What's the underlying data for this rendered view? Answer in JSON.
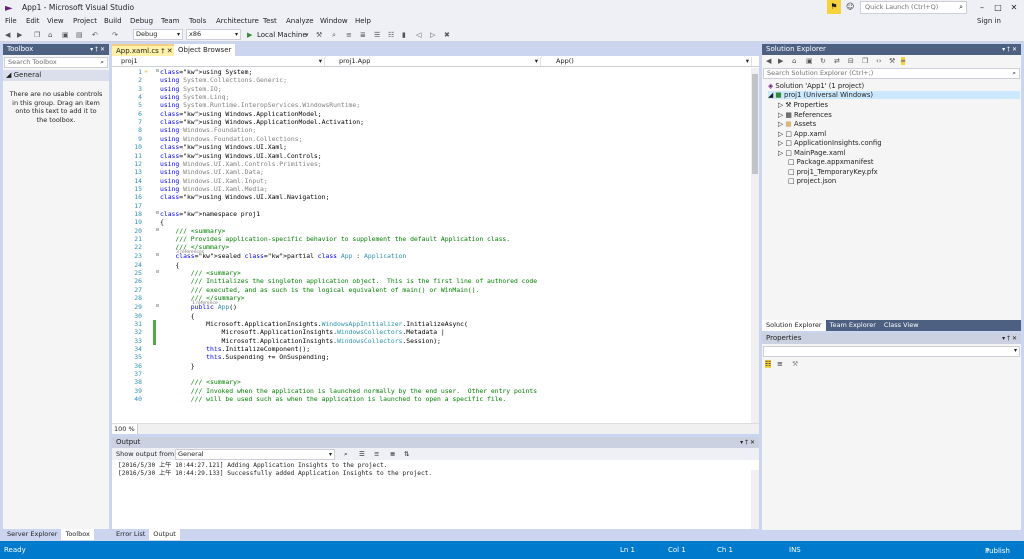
{
  "window": {
    "title": "App1 - Microsoft Visual Studio",
    "quick_launch": "Quick Launch (Ctrl+Q)",
    "sign_in": "Sign in"
  },
  "menu": [
    "File",
    "Edit",
    "View",
    "Project",
    "Build",
    "Debug",
    "Team",
    "Tools",
    "Architecture",
    "Test",
    "Analyze",
    "Window",
    "Help"
  ],
  "toolbar": {
    "config": "Debug",
    "platform": "x86",
    "run_label": "Local Machine"
  },
  "toolbox": {
    "title": "Toolbox",
    "search": "Search Toolbox",
    "group": "General",
    "empty_text": "There are no usable controls in this group. Drag an item onto this text to add it to the toolbox.",
    "tabs": [
      "Server Explorer",
      "Toolbox"
    ]
  },
  "editor": {
    "tabs": [
      "App.xaml.cs",
      "Object Browser"
    ],
    "nav": [
      "proj1",
      "proj1.App",
      "App()"
    ],
    "zoom": "100 %",
    "refs1": "3 references",
    "refs2": "1 reference",
    "lines": [
      {
        "n": "1",
        "t": "using System;"
      },
      {
        "n": "2",
        "t": "using System.Collections.Generic;"
      },
      {
        "n": "3",
        "t": "using System.IO;"
      },
      {
        "n": "4",
        "t": "using System.Linq;"
      },
      {
        "n": "5",
        "t": "using System.Runtime.InteropServices.WindowsRuntime;"
      },
      {
        "n": "6",
        "t": "using Windows.ApplicationModel;"
      },
      {
        "n": "7",
        "t": "using Windows.ApplicationModel.Activation;"
      },
      {
        "n": "8",
        "t": "using Windows.Foundation;"
      },
      {
        "n": "9",
        "t": "using Windows.Foundation.Collections;"
      },
      {
        "n": "10",
        "t": "using Windows.UI.Xaml;"
      },
      {
        "n": "11",
        "t": "using Windows.UI.Xaml.Controls;"
      },
      {
        "n": "12",
        "t": "using Windows.UI.Xaml.Controls.Primitives;"
      },
      {
        "n": "13",
        "t": "using Windows.UI.Xaml.Data;"
      },
      {
        "n": "14",
        "t": "using Windows.UI.Xaml.Input;"
      },
      {
        "n": "15",
        "t": "using Windows.UI.Xaml.Media;"
      },
      {
        "n": "16",
        "t": "using Windows.UI.Xaml.Navigation;"
      },
      {
        "n": "17",
        "t": ""
      },
      {
        "n": "18",
        "t": "namespace proj1"
      },
      {
        "n": "19",
        "t": "{"
      },
      {
        "n": "20",
        "t": "    /// <summary>"
      },
      {
        "n": "21",
        "t": "    /// Provides application-specific behavior to supplement the default Application class."
      },
      {
        "n": "22",
        "t": "    /// </summary>"
      },
      {
        "n": "23",
        "t": "    sealed partial class App : Application"
      },
      {
        "n": "24",
        "t": "    {"
      },
      {
        "n": "25",
        "t": "        /// <summary>"
      },
      {
        "n": "26",
        "t": "        /// Initializes the singleton application object.  This is the first line of authored code"
      },
      {
        "n": "27",
        "t": "        /// executed, and as such is the logical equivalent of main() or WinMain()."
      },
      {
        "n": "28",
        "t": "        /// </summary>"
      },
      {
        "n": "29",
        "t": "        public App()"
      },
      {
        "n": "30",
        "t": "        {"
      },
      {
        "n": "31",
        "t": "            Microsoft.ApplicationInsights.WindowsAppInitializer.InitializeAsync("
      },
      {
        "n": "32",
        "t": "                Microsoft.ApplicationInsights.WindowsCollectors.Metadata |"
      },
      {
        "n": "33",
        "t": "                Microsoft.ApplicationInsights.WindowsCollectors.Session);"
      },
      {
        "n": "34",
        "t": "            this.InitializeComponent();"
      },
      {
        "n": "35",
        "t": "            this.Suspending += OnSuspending;"
      },
      {
        "n": "36",
        "t": "        }"
      },
      {
        "n": "37",
        "t": ""
      },
      {
        "n": "38",
        "t": "        /// <summary>"
      },
      {
        "n": "39",
        "t": "        /// Invoked when the application is launched normally by the end user.  Other entry points"
      },
      {
        "n": "40",
        "t": "        /// will be used such as when the application is launched to open a specific file."
      }
    ]
  },
  "output": {
    "title": "Output",
    "show_from_label": "Show output from:",
    "source": "General",
    "lines": [
      "[2016/5/30 上午 10:44:27.121] Adding Application Insights to the project.",
      "[2016/5/30 上午 10:44:29.133] Successfully added Application Insights to the project."
    ],
    "tabs": [
      "Error List",
      "Output"
    ]
  },
  "solution_explorer": {
    "title": "Solution Explorer",
    "search": "Search Solution Explorer (Ctrl+;)",
    "items": [
      "Solution 'App1' (1 project)",
      "proj1 (Universal Windows)",
      "Properties",
      "References",
      "Assets",
      "App.xaml",
      "ApplicationInsights.config",
      "MainPage.xaml",
      "Package.appxmanifest",
      "proj1_TemporaryKey.pfx",
      "project.json"
    ],
    "tabs": [
      "Solution Explorer",
      "Team Explorer",
      "Class View"
    ]
  },
  "properties": {
    "title": "Properties"
  },
  "status": {
    "ready": "Ready",
    "ln": "Ln 1",
    "col": "Col 1",
    "ch": "Ch 1",
    "ins": "INS",
    "publish": "Publish"
  },
  "colors": {
    "accent": "#007acc",
    "panel_header": "#4d6082",
    "chrome": "#ccd5f0"
  }
}
